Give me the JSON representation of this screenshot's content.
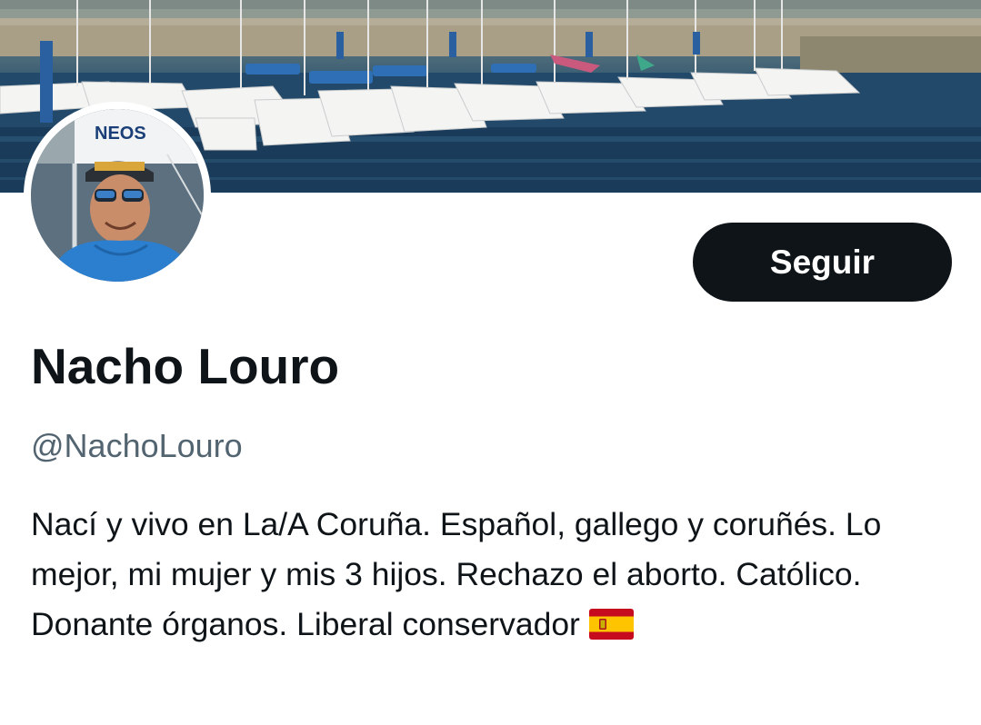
{
  "header": {
    "banner_icon": "marina-photo",
    "avatar_icon": "profile-photo",
    "avatar_cap_text": "NEOS"
  },
  "profile": {
    "display_name": "Nacho Louro",
    "handle": "@NachoLouro",
    "bio": "Nací y vivo en La/A Coruña. Español, gallego y coruñés. Lo mejor, mi mujer y mis 3 hijos. Rechazo el aborto. Católico. Donante órganos. Liberal conservador",
    "bio_emoji_icon": "spain-flag-icon"
  },
  "actions": {
    "follow_label": "Seguir"
  },
  "colors": {
    "text_primary": "#0f1419",
    "text_secondary": "#536471",
    "button_bg": "#0f1419",
    "button_text": "#ffffff",
    "flag_red": "#c60b1e",
    "flag_yellow": "#ffc400"
  }
}
